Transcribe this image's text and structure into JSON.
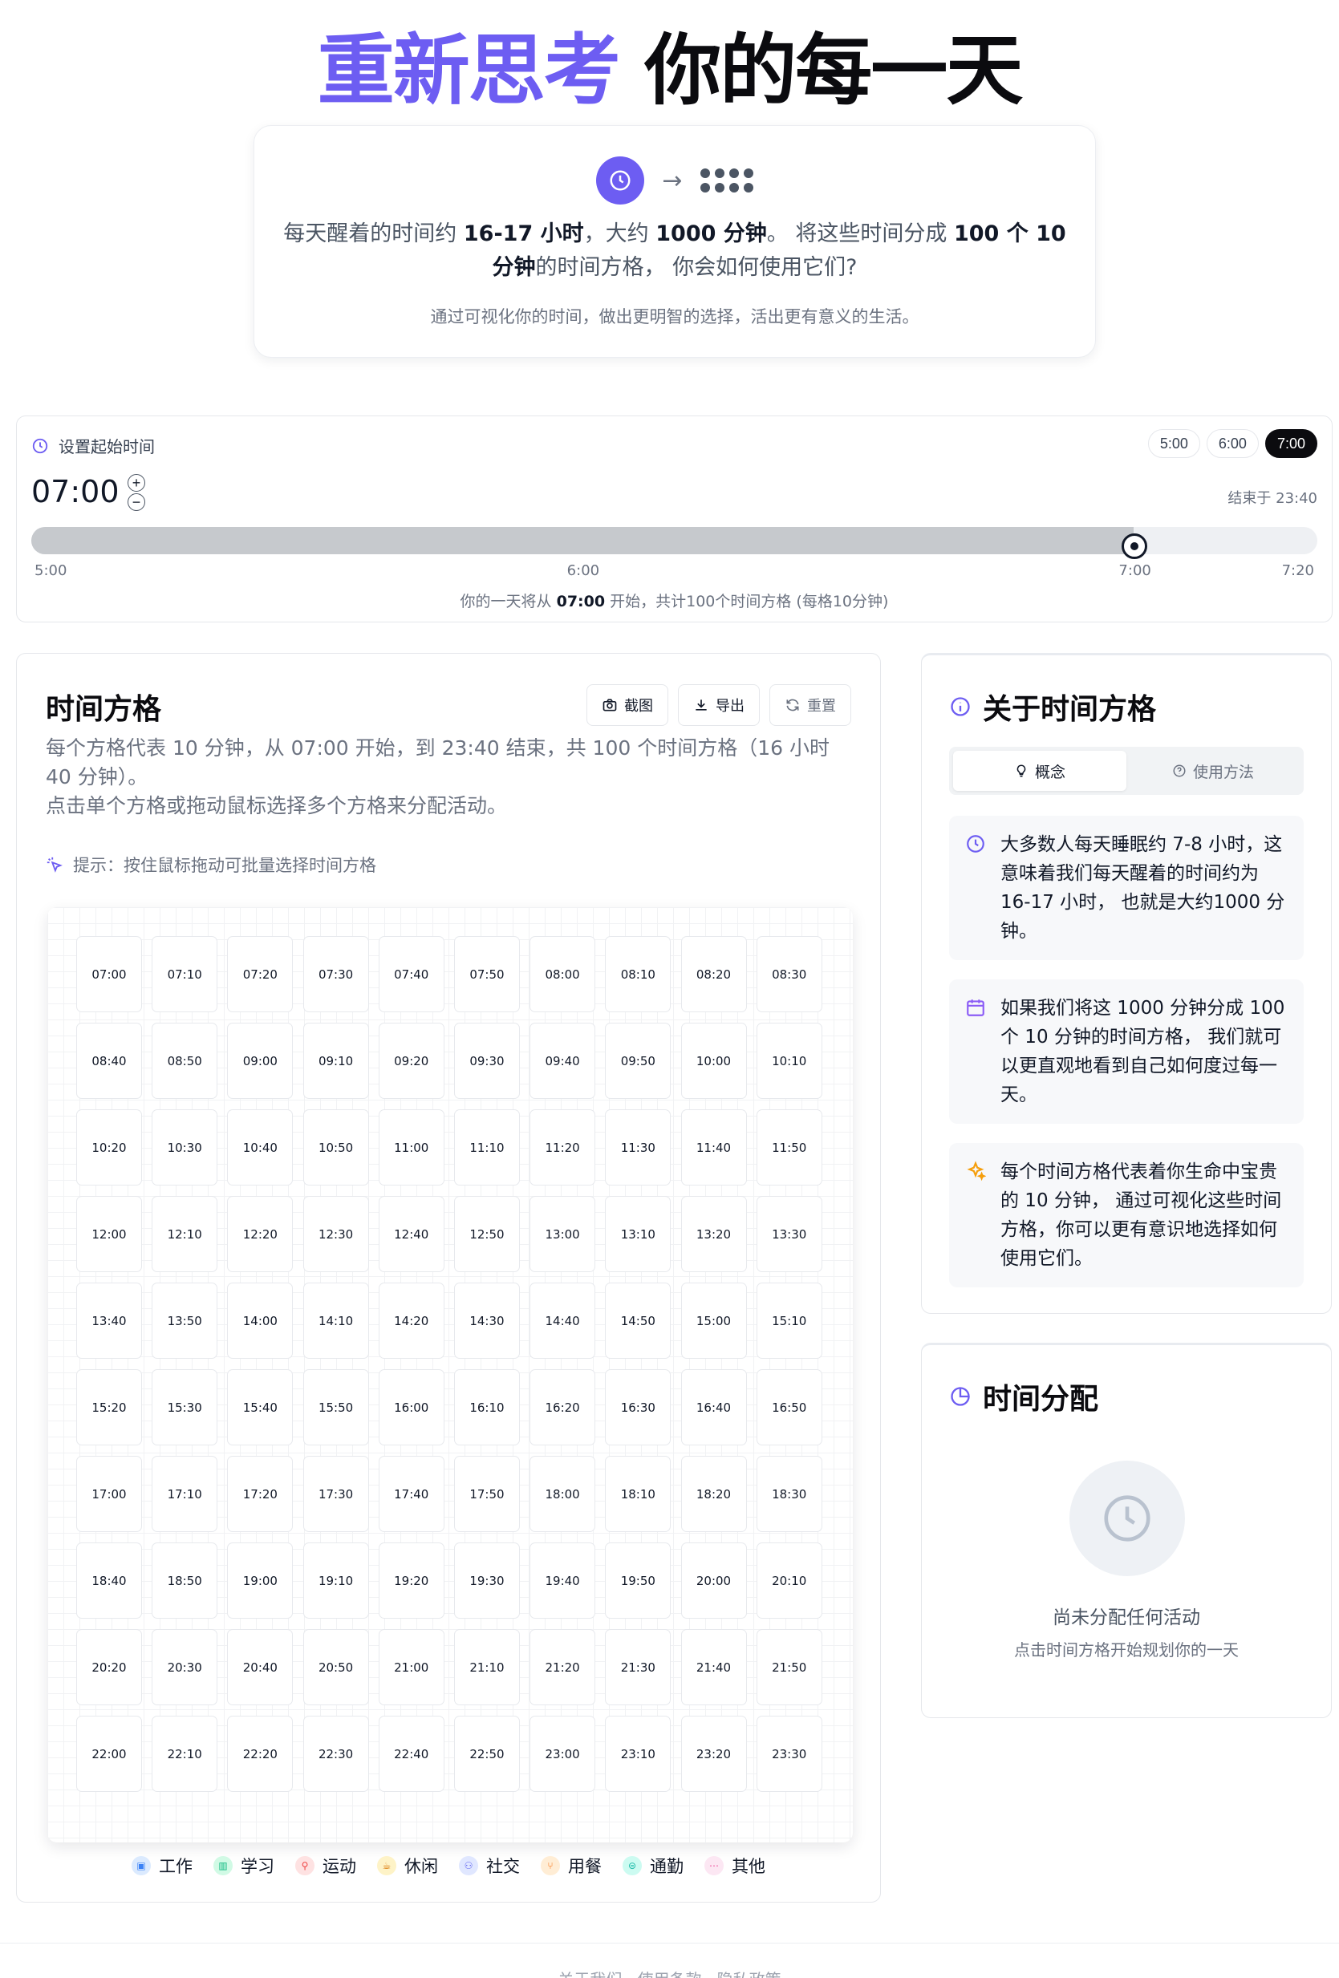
{
  "hero": {
    "title_accent": "重新思考",
    "title_rest": " 你的每一天",
    "intro_part1": "每天醒着的时间约 ",
    "intro_hours": "16-17 小时",
    "intro_part2": "，大约 ",
    "intro_minutes": "1000 分钟",
    "intro_part3": "。 将这些时间分成 ",
    "intro_blocks": "100 个 10 分钟",
    "intro_part4": "的时间方格， 你会如何使用它们?",
    "subtitle": "通过可视化你的时间，做出更明智的选择，活出更有意义的生活。",
    "icons": [
      "clock-icon",
      "arrow-right-icon",
      "dots-grid-icon"
    ]
  },
  "start": {
    "label": "设置起始时间",
    "presets": [
      "5:00",
      "6:00",
      "7:00"
    ],
    "active_preset": "7:00",
    "value": "07:00",
    "plus": "+",
    "minus": "−",
    "end_label": "结束于 23:40",
    "slider": {
      "min_label": "5:00",
      "max_label": "7:20",
      "position_fraction": 0.857
    },
    "ticks": [
      {
        "label": "5:00",
        "fraction": 0
      },
      {
        "label": "6:00",
        "fraction": 0.4286
      },
      {
        "label": "7:00",
        "fraction": 0.8571
      },
      {
        "label": "7:20",
        "fraction": 1
      }
    ],
    "summary_pre": "你的一天将从 ",
    "summary_time": "07:00",
    "summary_post": " 开始，共计100个时间方格 (每格10分钟)"
  },
  "grid": {
    "title": "时间方格",
    "screenshot_label": "截图",
    "export_label": "导出",
    "reset_label": "重置",
    "description_line1": "每个方格代表 10 分钟，从 07:00 开始，到 23:40 结束，共 100 个时间方格（16 小时 40 分钟）。",
    "description_line2": "点击单个方格或拖动鼠标选择多个方格来分配活动。",
    "tip": "提示：按住鼠标拖动可批量选择时间方格",
    "cells": [
      "07:00",
      "07:10",
      "07:20",
      "07:30",
      "07:40",
      "07:50",
      "08:00",
      "08:10",
      "08:20",
      "08:30",
      "08:40",
      "08:50",
      "09:00",
      "09:10",
      "09:20",
      "09:30",
      "09:40",
      "09:50",
      "10:00",
      "10:10",
      "10:20",
      "10:30",
      "10:40",
      "10:50",
      "11:00",
      "11:10",
      "11:20",
      "11:30",
      "11:40",
      "11:50",
      "12:00",
      "12:10",
      "12:20",
      "12:30",
      "12:40",
      "12:50",
      "13:00",
      "13:10",
      "13:20",
      "13:30",
      "13:40",
      "13:50",
      "14:00",
      "14:10",
      "14:20",
      "14:30",
      "14:40",
      "14:50",
      "15:00",
      "15:10",
      "15:20",
      "15:30",
      "15:40",
      "15:50",
      "16:00",
      "16:10",
      "16:20",
      "16:30",
      "16:40",
      "16:50",
      "17:00",
      "17:10",
      "17:20",
      "17:30",
      "17:40",
      "17:50",
      "18:00",
      "18:10",
      "18:20",
      "18:30",
      "18:40",
      "18:50",
      "19:00",
      "19:10",
      "19:20",
      "19:30",
      "19:40",
      "19:50",
      "20:00",
      "20:10",
      "20:20",
      "20:30",
      "20:40",
      "20:50",
      "21:00",
      "21:10",
      "21:20",
      "21:30",
      "21:40",
      "21:50",
      "22:00",
      "22:10",
      "22:20",
      "22:30",
      "22:40",
      "22:50",
      "23:00",
      "23:10",
      "23:20",
      "23:30"
    ],
    "legend": [
      {
        "label": "工作",
        "icon": "briefcase-icon",
        "color": "#3b82f6",
        "bg": "#dbeafe",
        "glyph": "▣"
      },
      {
        "label": "学习",
        "icon": "book-icon",
        "color": "#10b981",
        "bg": "#d1fae5",
        "glyph": "▥"
      },
      {
        "label": "运动",
        "icon": "dumbbell-icon",
        "color": "#ef4444",
        "bg": "#fee2e2",
        "glyph": "⚲"
      },
      {
        "label": "休闲",
        "icon": "coffee-icon",
        "color": "#d97706",
        "bg": "#fef3c7",
        "glyph": "☕"
      },
      {
        "label": "社交",
        "icon": "users-icon",
        "color": "#6366f1",
        "bg": "#e0e7ff",
        "glyph": "⚇"
      },
      {
        "label": "用餐",
        "icon": "utensils-icon",
        "color": "#f97316",
        "bg": "#ffedd5",
        "glyph": "⑂"
      },
      {
        "label": "通勤",
        "icon": "car-icon",
        "color": "#14b8a6",
        "bg": "#ccfbf1",
        "glyph": "⊜"
      },
      {
        "label": "其他",
        "icon": "more-icon",
        "color": "#ec4899",
        "bg": "#fce7f3",
        "glyph": "⋯"
      }
    ]
  },
  "about": {
    "title": "关于时间方格",
    "tab_concept": "概念",
    "tab_usage": "使用方法",
    "blocks": [
      {
        "icon": "clock-icon",
        "text": "大多数人每天睡眠约 7-8 小时，这意味着我们每天醒着的时间约为 16-17 小时， 也就是大约1000 分钟。"
      },
      {
        "icon": "calendar-icon",
        "text": "如果我们将这 1000 分钟分成 100 个 10 分钟的时间方格， 我们就可以更直观地看到自己如何度过每一天。"
      },
      {
        "icon": "sparkles-icon",
        "text": "每个时间方格代表着你生命中宝贵的 10 分钟， 通过可视化这些时间方格，你可以更有意识地选择如何使用它们。"
      }
    ]
  },
  "distribution": {
    "title": "时间分配",
    "empty_title": "尚未分配任何活动",
    "empty_sub": "点击时间方格开始规划你的一天"
  },
  "footer": {
    "links": "关于我们 · 使用条款 · 隐私政策"
  },
  "colors": {
    "accent": "#6d5df2",
    "dark": "#0b0b0f",
    "muted": "#6b7280"
  }
}
